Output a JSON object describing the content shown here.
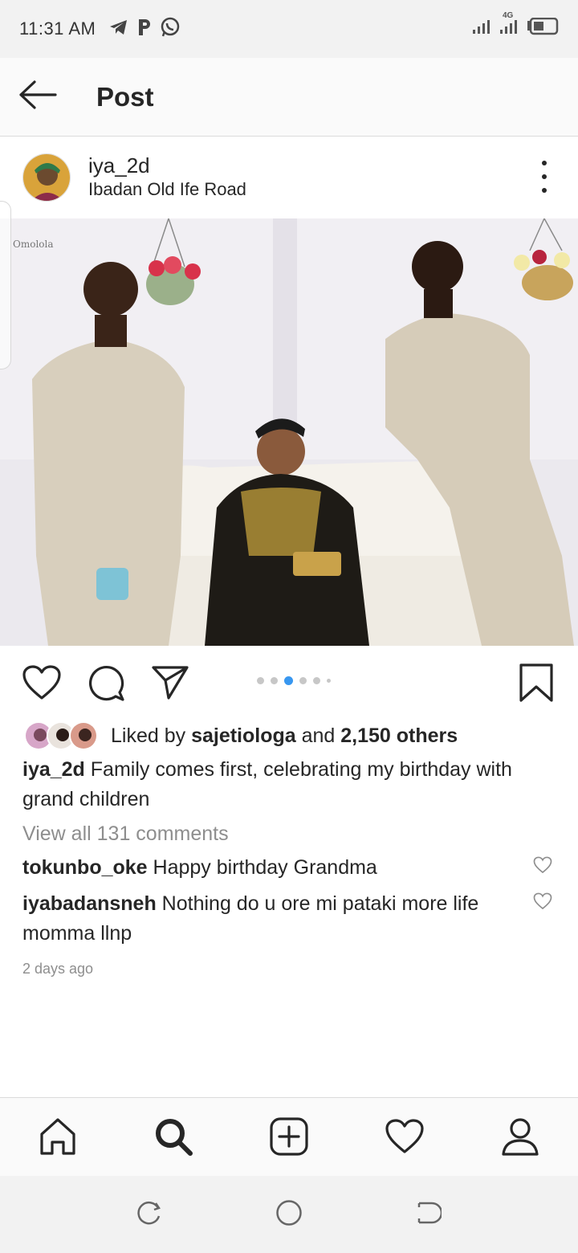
{
  "status_bar": {
    "time": "11:31 AM",
    "app_icons": [
      "telegram-icon",
      "p-icon",
      "whatsapp-icon"
    ],
    "network": "4G",
    "signal_icons": [
      "signal-icon",
      "signal-4g-icon"
    ],
    "battery_icon": "battery-icon"
  },
  "header": {
    "back_icon": "back-arrow-icon",
    "title": "Post"
  },
  "post": {
    "username": "iya_2d",
    "location": "Ibadan Old Ife Road",
    "more_icon": "more-vertical-icon",
    "carousel": {
      "total_dots": 6,
      "active_index": 2
    },
    "likes": {
      "prefix": "Liked by ",
      "liker": "sajetiologa",
      "middle": " and ",
      "others": "2,150 others"
    },
    "caption": {
      "username": "iya_2d",
      "text": " Family comes first, celebrating my birthday with grand children"
    },
    "view_all_comments": "View all 131 comments",
    "comments": [
      {
        "username": "tokunbo_oke",
        "text": " Happy birthday Grandma"
      },
      {
        "username": "iyabadansneh",
        "text": " Nothing do u ore mi pataki more life momma llnp"
      }
    ],
    "timestamp": "2 days ago"
  },
  "actions": [
    "like-icon",
    "comment-icon",
    "share-icon",
    "bookmark-icon"
  ],
  "bottom_nav": [
    "home-icon",
    "search-icon",
    "new-post-icon",
    "activity-icon",
    "profile-icon"
  ],
  "system_nav": [
    "recent-apps-icon",
    "home-circle-icon",
    "back-icon"
  ],
  "colors": {
    "accent": "#3897f0",
    "text": "#262626",
    "muted": "#8e8e8e"
  }
}
